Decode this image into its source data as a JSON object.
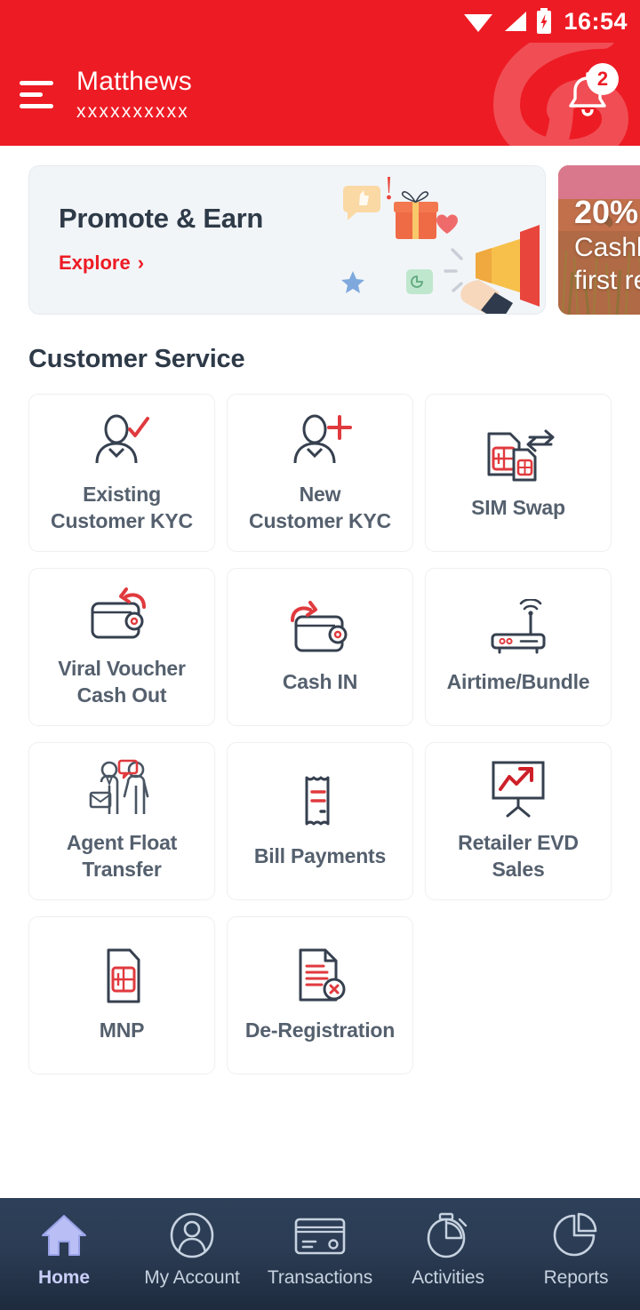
{
  "status_bar": {
    "time": "16:54",
    "icons": [
      "wifi-icon",
      "cellular-signal-icon",
      "battery-charging-icon"
    ]
  },
  "app_bar": {
    "menu_icon": "hamburger-menu-icon",
    "user_name": "Matthews",
    "user_msisdn": "xxxxxxxxxx",
    "notification_icon": "bell-icon",
    "notification_count": "2",
    "brand_color": "#ED1B24"
  },
  "promos": [
    {
      "title": "Promote & Earn",
      "cta": "Explore",
      "cta_chevron": "›",
      "art": "megaphone-gift-illustration"
    },
    {
      "line1": "20%",
      "line2": "Cashback",
      "line3": "first recharge"
    }
  ],
  "section": {
    "title": "Customer Service"
  },
  "services": [
    {
      "label": "Existing\nCustomer KYC",
      "icon": "user-verified-icon"
    },
    {
      "label": "New\nCustomer KYC",
      "icon": "user-add-icon"
    },
    {
      "label": "SIM Swap",
      "icon": "sim-swap-icon"
    },
    {
      "label": "Viral Voucher\nCash Out",
      "icon": "wallet-cash-out-icon"
    },
    {
      "label": "Cash IN",
      "icon": "wallet-cash-in-icon"
    },
    {
      "label": "Airtime/Bundle",
      "icon": "router-wifi-icon"
    },
    {
      "label": "Agent Float\nTransfer",
      "icon": "agent-transfer-icon"
    },
    {
      "label": "Bill Payments",
      "icon": "receipt-icon"
    },
    {
      "label": "Retailer EVD\nSales",
      "icon": "sales-chart-board-icon"
    },
    {
      "label": "MNP",
      "icon": "sim-card-icon"
    },
    {
      "label": "De-Registration",
      "icon": "document-remove-icon"
    }
  ],
  "bottom_nav": {
    "active_index": 0,
    "items": [
      {
        "label": "Home",
        "icon": "home-icon"
      },
      {
        "label": "My Account",
        "icon": "user-circle-icon"
      },
      {
        "label": "Transactions",
        "icon": "credit-card-icon"
      },
      {
        "label": "Activities",
        "icon": "stopwatch-icon"
      },
      {
        "label": "Reports",
        "icon": "pie-chart-icon"
      }
    ]
  },
  "colors": {
    "brand_red": "#ED1B24",
    "icon_dark": "#36404F",
    "icon_red": "#E03A3E",
    "text_slate": "#55606E",
    "nav_active": "#C9CEF8"
  }
}
